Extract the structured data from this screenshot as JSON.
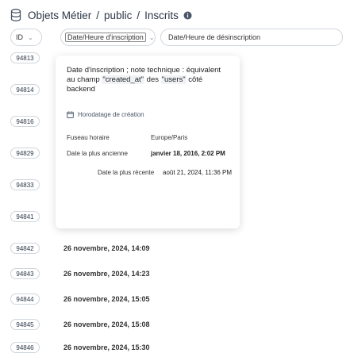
{
  "breadcrumb": {
    "items": [
      "Objets Métier",
      "public",
      "Inscrits"
    ],
    "separator": "/"
  },
  "columns": {
    "id": "ID",
    "inscription": "Date/Heure d'inscription",
    "desinscription": "Date/Heure de désinscription"
  },
  "rows": [
    {
      "id": "94813",
      "date": ""
    },
    {
      "id": "94814",
      "date": ""
    },
    {
      "id": "94816",
      "date": ""
    },
    {
      "id": "94829",
      "date": ""
    },
    {
      "id": "94833",
      "date": ""
    },
    {
      "id": "94841",
      "date": ""
    },
    {
      "id": "94842",
      "date": "26 novembre, 2024, 14:09"
    },
    {
      "id": "94843",
      "date": "26 novembre, 2024, 14:23"
    },
    {
      "id": "94844",
      "date": "26 novembre, 2024, 15:05"
    },
    {
      "id": "94845",
      "date": "26 novembre, 2024, 15:08"
    },
    {
      "id": "94846",
      "date": "26 novembre, 2024, 15:30"
    }
  ],
  "tooltip": {
    "desc_prefix": "Date d'inscription ; note technique : équivalent au champ ",
    "field": "\"created_at\"",
    "desc_mid": " des ",
    "users": "\"users\"",
    "desc_suffix": " côté backend",
    "section": "Horodatage de création",
    "tz_label": "Fuseau horaire",
    "tz_value": "Europe/Paris",
    "oldest_label": "Date la plus ancienne",
    "oldest_value": "janvier 18, 2016, 2:02 PM",
    "newest_label": "Date la plus récente",
    "newest_value": "août 21, 2024, 11:36 PM"
  }
}
